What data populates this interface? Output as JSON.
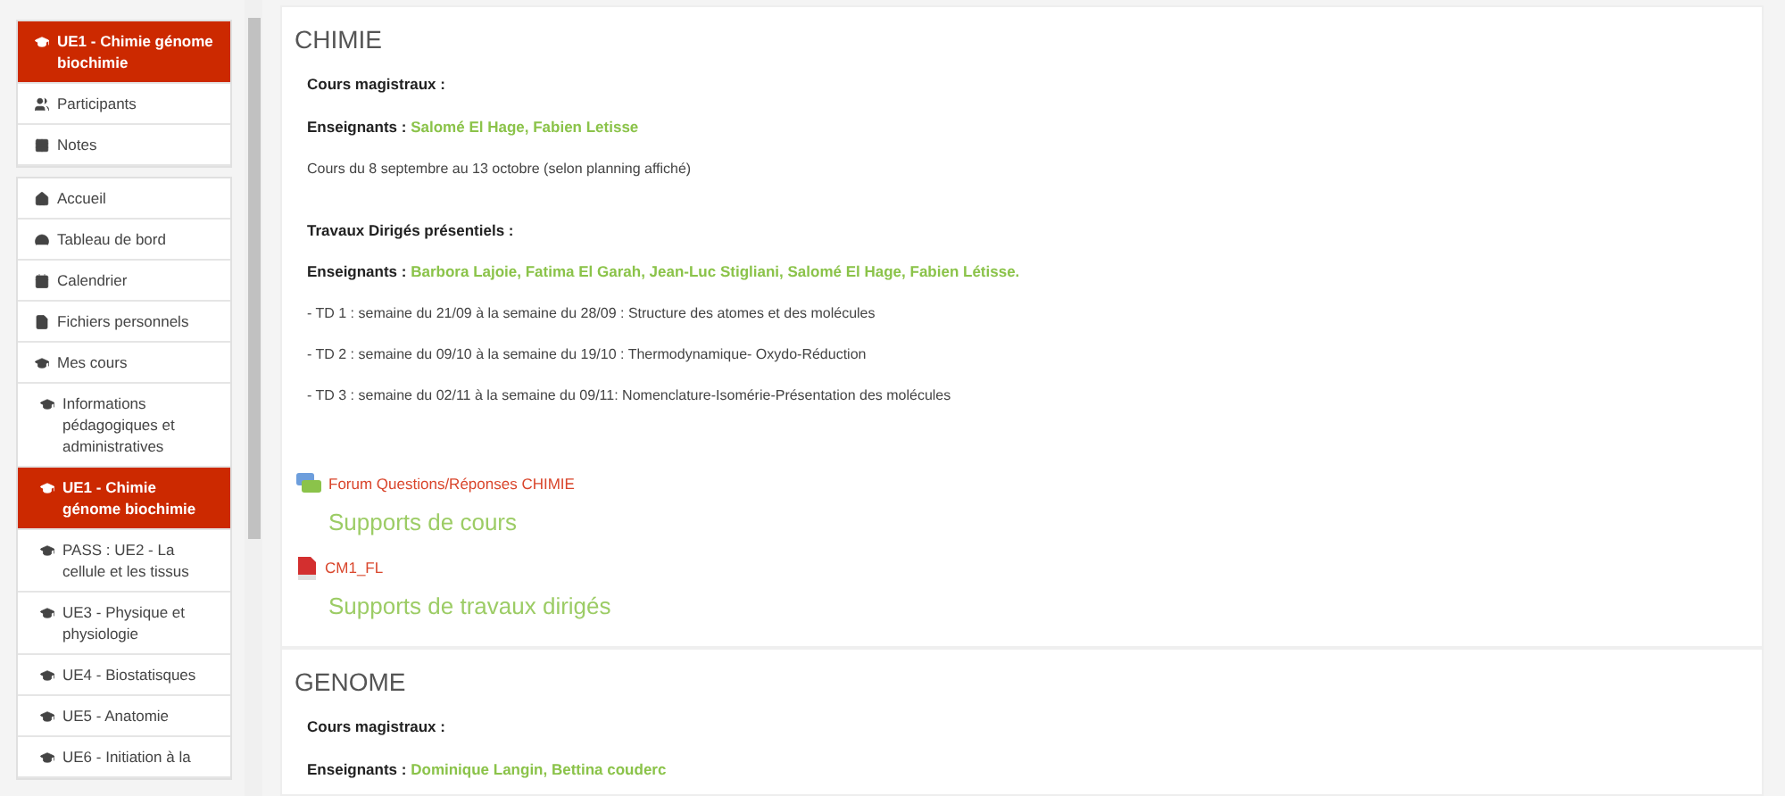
{
  "sidebar": {
    "blocks": [
      {
        "items": [
          {
            "label": "UE1 - Chimie génome biochimie",
            "selected": true
          },
          {
            "label": "Participants",
            "selected": false
          },
          {
            "label": "Notes",
            "selected": false
          }
        ]
      },
      {
        "items": [
          {
            "label": "Accueil",
            "selected": false
          },
          {
            "label": "Tableau de bord",
            "selected": false
          },
          {
            "label": "Calendrier",
            "selected": false
          },
          {
            "label": "Fichiers personnels",
            "selected": false
          },
          {
            "label": "Mes cours",
            "selected": false,
            "children": [
              {
                "label": "Informations pédagogiques et administratives",
                "selected": false
              },
              {
                "label": "UE1 - Chimie génome biochimie",
                "selected": true
              },
              {
                "label": "PASS : UE2 - La cellule et les tissus",
                "selected": false
              },
              {
                "label": "UE3 - Physique et physiologie",
                "selected": false
              },
              {
                "label": "UE4 - Biostatisques",
                "selected": false
              },
              {
                "label": "UE5 - Anatomie",
                "selected": false
              },
              {
                "label": "UE6 - Initiation à la",
                "selected": false
              }
            ]
          }
        ]
      }
    ]
  },
  "sections": [
    {
      "title": "CHIMIE",
      "lines": [
        {
          "kind": "heading",
          "text": "Cours magistraux :"
        },
        {
          "kind": "teachers",
          "label": "Enseignants :",
          "names": "Salomé El Hage, Fabien Letisse"
        },
        {
          "kind": "text",
          "text": "Cours du 8 septembre au 13 octobre (selon planning affiché)"
        },
        {
          "kind": "heading",
          "text": "Travaux Dirigés présentiels :"
        },
        {
          "kind": "teachers",
          "label": "Enseignants :",
          "names": "Barbora Lajoie, Fatima El Garah, Jean-Luc Stigliani, Salomé El Hage, Fabien Létisse."
        },
        {
          "kind": "text",
          "text": "- TD 1 : semaine du 21/09 à la semaine du 28/09 : Structure des atomes et des molécules"
        },
        {
          "kind": "text",
          "text": "- TD 2 : semaine du 09/10 à la semaine du 19/10 : Thermodynamique- Oxydo-Réduction"
        },
        {
          "kind": "text",
          "text": "- TD 3 : semaine du 02/11 à la semaine du 09/11: Nomenclature-Isomérie-Présentation des molécules"
        },
        {
          "kind": "forum",
          "text": "Forum Questions/Réponses CHIMIE"
        },
        {
          "kind": "subheading",
          "text": "Supports de cours"
        },
        {
          "kind": "pdf",
          "text": "CM1_FL"
        },
        {
          "kind": "subheading",
          "text": "Supports de travaux dirigés"
        }
      ]
    },
    {
      "title": "GENOME",
      "lines": [
        {
          "kind": "heading",
          "text": "Cours magistraux :"
        },
        {
          "kind": "teachers",
          "label": "Enseignants :",
          "names": "Dominique Langin, Bettina couderc"
        }
      ]
    }
  ]
}
